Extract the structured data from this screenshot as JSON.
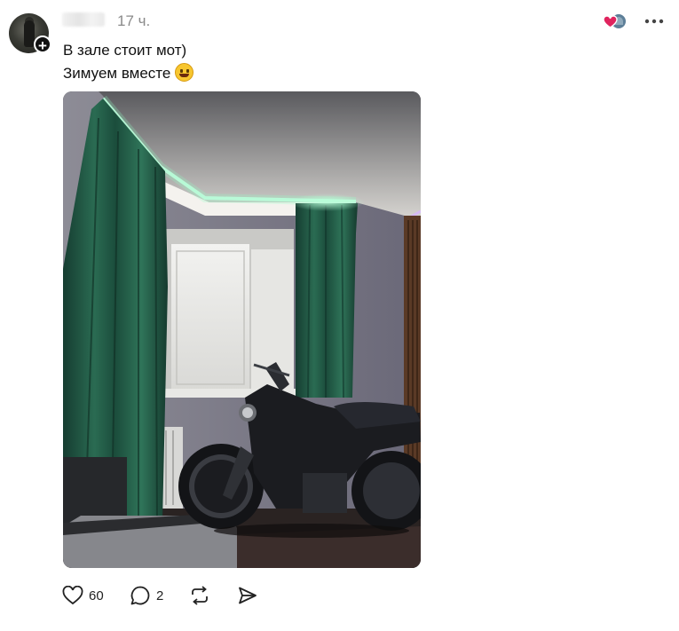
{
  "post": {
    "time": "17 ч.",
    "text_line1": "В зале стоит мот)",
    "text_line2": "Зимуем вместе",
    "emoji": "grinning-face-emoji"
  },
  "actions": {
    "likes": "60",
    "comments": "2"
  },
  "colors": {
    "like_heart": "#e0245e",
    "curtain": "#1f5a45",
    "led_glow": "#7fffc0"
  },
  "icons": [
    "follow-plus-icon",
    "liked-by-icon",
    "more-icon",
    "heart-icon",
    "comment-icon",
    "repost-icon",
    "share-icon"
  ]
}
